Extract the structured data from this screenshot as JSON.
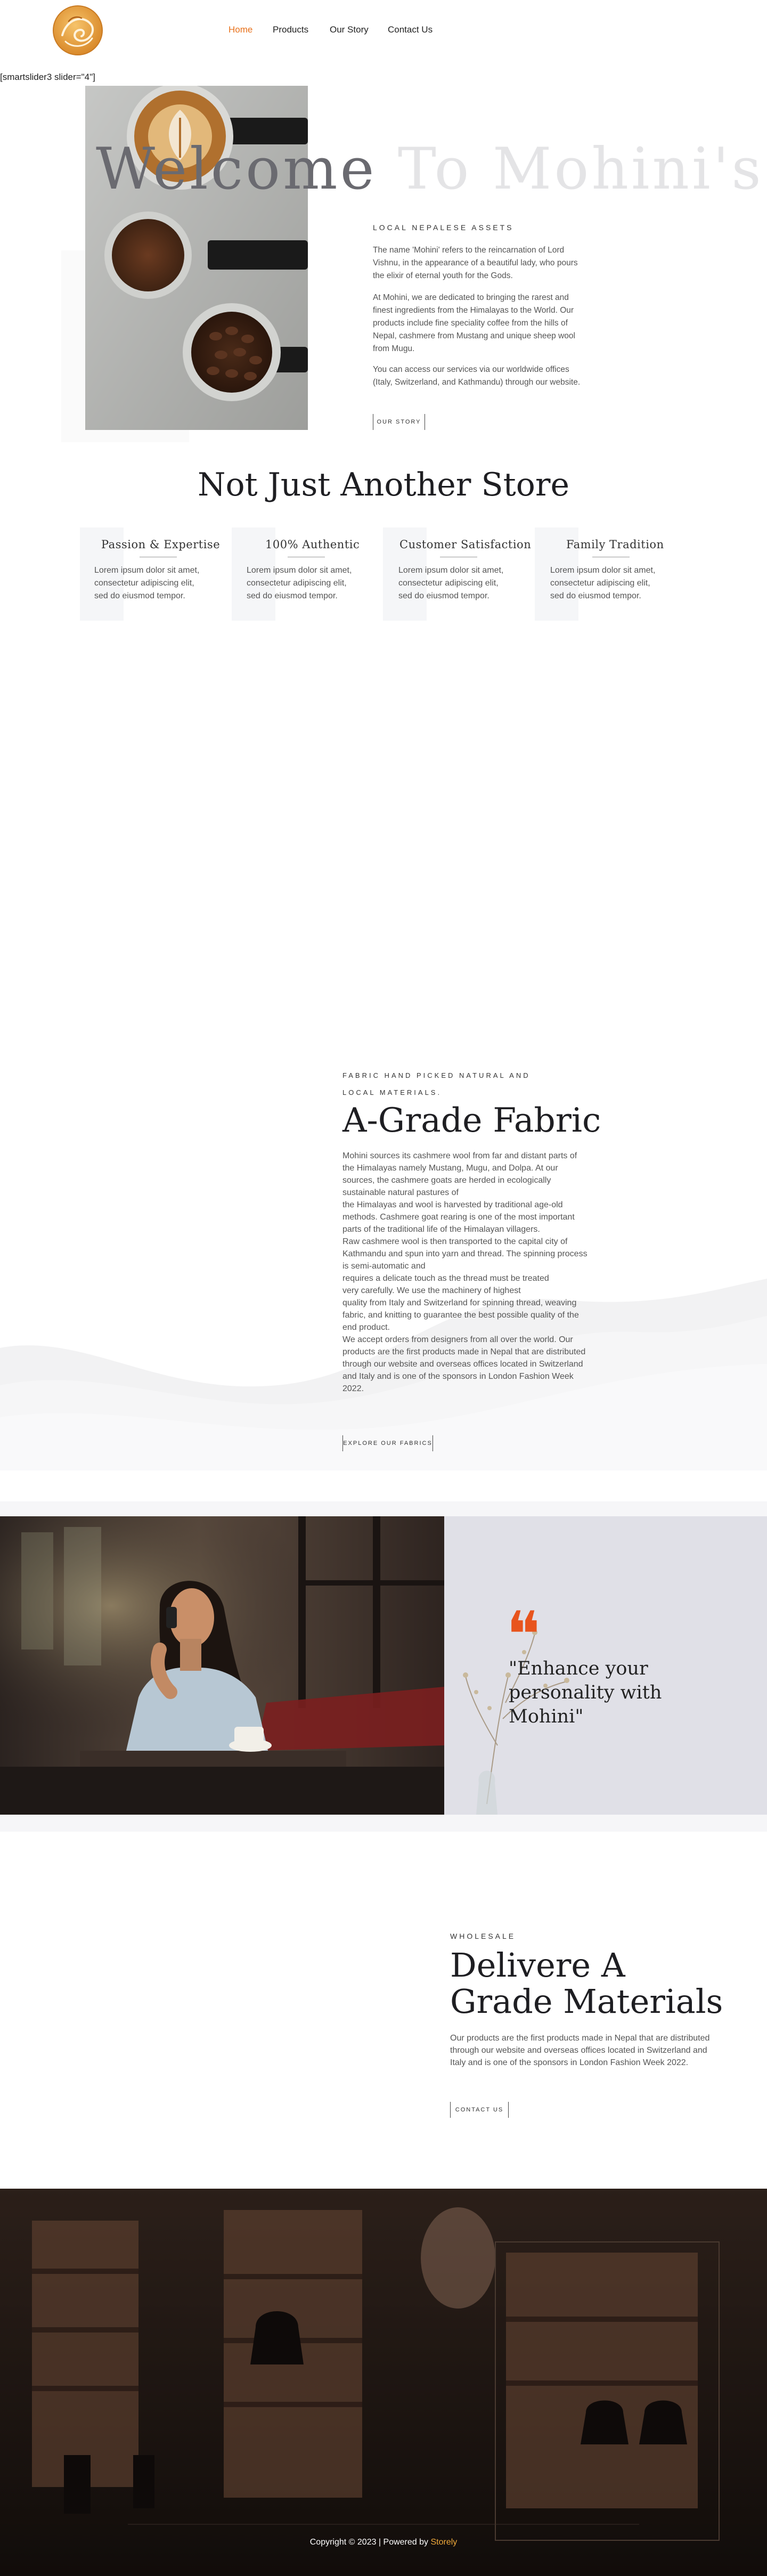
{
  "nav": {
    "items": [
      {
        "label": "Home",
        "active": true
      },
      {
        "label": "Products",
        "active": false
      },
      {
        "label": "Our Story",
        "active": false
      },
      {
        "label": "Contact Us",
        "active": false
      }
    ]
  },
  "shortcode": "[smartslider3 slider=\"4\"]",
  "welcome": {
    "title_dark": "Welcome",
    "title_light": " To Mohini's",
    "heading": "LOCAL NEPALESE ASSETS",
    "paragraphs": [
      "The name 'Mohini' refers to the reincarnation of Lord Vishnu, in the appearance of a beautiful lady, who pours the elixir of eternal youth for the Gods.",
      "At Mohini, we are dedicated to bringing the rarest and finest ingredients from the Himalayas to the World. Our products include fine speciality coffee from the hills of Nepal, cashmere from Mustang and unique sheep wool from Mugu.",
      "You can access our services via our worldwide offices (Italy, Switzerland, and Kathmandu) through our website."
    ],
    "button": "OUR STORY"
  },
  "store": {
    "title": "Not Just Another Store",
    "features": [
      {
        "title": "Passion & Expertise",
        "text": "Lorem ipsum dolor sit amet, consectetur adipiscing elit, sed do eiusmod tempor."
      },
      {
        "title": "100% Authentic",
        "text": "Lorem ipsum dolor sit amet, consectetur adipiscing elit, sed do eiusmod tempor."
      },
      {
        "title": "Customer Satisfaction",
        "text": "Lorem ipsum dolor sit amet, consectetur adipiscing elit, sed do eiusmod tempor."
      },
      {
        "title": "Family Tradition",
        "text": "Lorem ipsum dolor sit amet, consectetur adipiscing elit, sed do eiusmod tempor."
      }
    ]
  },
  "fabric": {
    "eyebrow": "FABRIC HAND PICKED NATURAL AND LOCAL MATERIALS.",
    "title": "A-Grade Fabric",
    "lines": [
      "Mohini sources its cashmere wool from far and distant parts of",
      "the Himalayas namely Mustang, Mugu, and Dolpa. At our",
      "sources, the cashmere goats are herded in ecologically",
      "sustainable natural pastures of",
      "the Himalayas and wool is harvested by traditional age-old",
      "methods. Cashmere goat rearing is one of the most important",
      "parts of the traditional life of the Himalayan villagers.",
      " Raw cashmere wool is then transported to the capital city of",
      "Kathmandu and spun into yarn and thread. The spinning process",
      "is semi-automatic and",
      "requires a delicate touch as the thread must be treated",
      "very carefully.  We use the machinery of highest",
      "quality from Italy and Switzerland for spinning thread, weaving",
      "fabric, and knitting to guarantee the best possible quality of the",
      "end product.",
      "We accept orders from designers from all over the world. Our",
      "products are the first products made in Nepal that are distributed",
      "through our website and overseas offices located in Switzerland",
      "and Italy and is one of the sponsors in London Fashion Week",
      "2022."
    ],
    "button": "EXPLORE OUR FABRICS"
  },
  "quote": {
    "mark": "❝",
    "text": "\"Enhance your personality with Mohini\""
  },
  "wholesale": {
    "eyebrow": "WHOLESALE",
    "title": "Delivere A Grade Materials",
    "body": "Our products are the first products made in Nepal that are distributed through our website and overseas offices located in Switzerland and Italy and is one of the sponsors in London Fashion Week 2022.",
    "button": "CONTACT US"
  },
  "footer": {
    "copyright": "Copyright © 2023 | Powered by ",
    "powered_by": "Storely"
  },
  "colors": {
    "accent": "#e8711b",
    "quote_mark": "#e8541d",
    "footer_link": "#f0a93b"
  }
}
